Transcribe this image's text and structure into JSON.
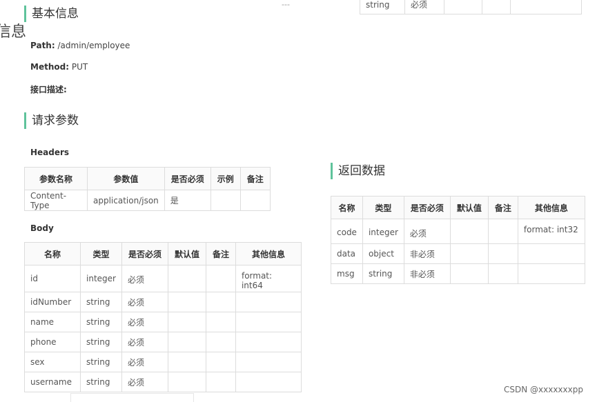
{
  "edge_fragment": "信息",
  "basic": {
    "title": "基本信息",
    "path_label": "Path:",
    "path_value": "/admin/employee",
    "method_label": "Method:",
    "method_value": "PUT",
    "desc_label": "接口描述:"
  },
  "request": {
    "title": "请求参数",
    "headers_label": "Headers",
    "headers_columns": [
      "参数名称",
      "参数值",
      "是否必须",
      "示例",
      "备注"
    ],
    "headers_rows": [
      [
        "Content-Type",
        "application/json",
        "是",
        "",
        ""
      ]
    ],
    "body_label": "Body",
    "body_columns": [
      "名称",
      "类型",
      "是否必须",
      "默认值",
      "备注",
      "其他信息"
    ],
    "body_rows": [
      [
        "id",
        "integer",
        "必须",
        "",
        "",
        "format: int64"
      ],
      [
        "idNumber",
        "string",
        "必须",
        "",
        "",
        ""
      ],
      [
        "name",
        "string",
        "必须",
        "",
        "",
        ""
      ],
      [
        "phone",
        "string",
        "必须",
        "",
        "",
        ""
      ],
      [
        "sex",
        "string",
        "必须",
        "",
        "",
        ""
      ],
      [
        "username",
        "string",
        "必须",
        "",
        "",
        ""
      ]
    ]
  },
  "top_fragment": {
    "left_text": "---",
    "row": [
      "string",
      "必须"
    ]
  },
  "response": {
    "title": "返回数据",
    "columns": [
      "名称",
      "类型",
      "是否必须",
      "默认值",
      "备注",
      "其他信息"
    ],
    "rows": [
      [
        "code",
        "integer",
        "必须",
        "",
        "",
        "format: int32"
      ],
      [
        "data",
        "object",
        "非必须",
        "",
        "",
        ""
      ],
      [
        "msg",
        "string",
        "非必须",
        "",
        "",
        ""
      ]
    ]
  },
  "watermark": "CSDN @xxxxxxxpp",
  "colors": {
    "accent": "#5fc39b",
    "border": "#dcdcdc"
  }
}
